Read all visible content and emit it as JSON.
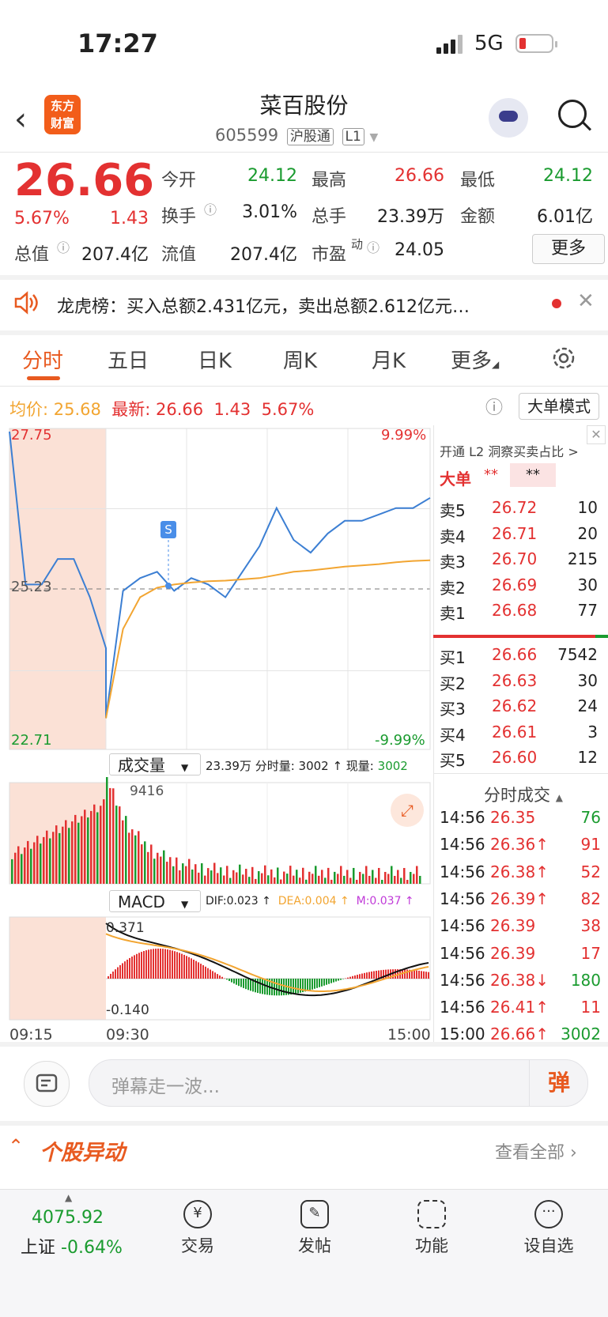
{
  "status_bar": {
    "time": "17:27",
    "network": "5G"
  },
  "header": {
    "title": "菜百股份",
    "code": "605599",
    "tag1": "沪股通",
    "tag2": "L1",
    "logo_line1": "东方",
    "logo_line2": "财富"
  },
  "quote": {
    "price": "26.66",
    "change_pct": "5.67%",
    "change": "1.43",
    "open_label": "今开",
    "open": "24.12",
    "high_label": "最高",
    "high": "26.66",
    "low_label": "最低",
    "low": "24.12",
    "turnover_label": "换手",
    "turnover": "3.01%",
    "volume_label": "总手",
    "volume": "23.39万",
    "amount_label": "金额",
    "amount": "6.01亿",
    "mktcap_label": "总值",
    "mktcap": "207.4亿",
    "float_label": "流值",
    "float": "207.4亿",
    "pe_label": "市盈",
    "pe_sup": "动",
    "pe": "24.05",
    "more_button": "更多"
  },
  "notice": {
    "text": "龙虎榜：买入总额2.431亿元，卖出总额2.612亿元…"
  },
  "tabs": [
    {
      "label": "分时"
    },
    {
      "label": "五日"
    },
    {
      "label": "日K"
    },
    {
      "label": "周K"
    },
    {
      "label": "月K"
    },
    {
      "label": "更多"
    }
  ],
  "avg_line": {
    "avg_label": "均价:",
    "avg": "25.68",
    "latest_label": "最新:",
    "latest": "26.66",
    "chg": "1.43",
    "pct": "5.67%"
  },
  "mode_button": "大单模式",
  "chart_labels": {
    "top_left": "27.75",
    "mid_left": "25.23",
    "bottom_left": "22.71",
    "top_right": "9.99%",
    "bottom_right": "-9.99%",
    "vol_selector": "成交量",
    "vol_info": "23.39万 分时量: 3002 ↑ 现量:",
    "vol_now": "3002",
    "vol_max": "9416",
    "macd_selector": "MACD",
    "dif": "DIF:0.023 ↑",
    "dea": "DEA:0.004 ↑",
    "m": "M:0.037 ↑",
    "macd_top": "0.371",
    "macd_bottom": "-0.140",
    "t_start": "09:15",
    "t_open": "09:30",
    "t_end": "15:00",
    "marker": "S"
  },
  "chart_data": {
    "type": "line",
    "ylim": [
      22.71,
      27.75
    ],
    "prev_close": 25.23,
    "x": [
      "09:15",
      "09:17",
      "09:19",
      "09:20",
      "09:22",
      "09:24",
      "09:25",
      "09:30",
      "09:35",
      "09:45",
      "09:55",
      "10:05",
      "10:20",
      "10:35",
      "10:50",
      "11:05",
      "11:15",
      "11:30",
      "13:15",
      "13:30",
      "13:45",
      "14:00",
      "14:15",
      "14:30",
      "14:45",
      "14:56",
      "15:00"
    ],
    "series": [
      {
        "values": [
          27.7,
          25.3,
          25.3,
          25.7,
          25.7,
          25.1,
          24.3,
          23.2,
          25.2,
          25.4,
          25.5,
          25.2,
          25.4,
          25.3,
          25.1,
          25.5,
          25.9,
          26.5,
          26.0,
          25.8,
          26.1,
          26.3,
          26.3,
          26.4,
          26.5,
          26.5,
          26.66
        ]
      },
      {
        "values": [
          null,
          null,
          null,
          null,
          null,
          null,
          null,
          23.2,
          24.6,
          25.1,
          25.25,
          25.3,
          25.33,
          25.35,
          25.36,
          25.38,
          25.4,
          25.45,
          25.5,
          25.52,
          25.55,
          25.58,
          25.6,
          25.62,
          25.65,
          25.67,
          25.68
        ]
      }
    ]
  },
  "order_book": {
    "header": "开通 L2 洞察买卖占比 >",
    "big_label": "大单",
    "big_val": "**",
    "big_val2": "**",
    "asks": [
      {
        "label": "卖5",
        "price": "26.72",
        "qty": "10"
      },
      {
        "label": "卖4",
        "price": "26.71",
        "qty": "20"
      },
      {
        "label": "卖3",
        "price": "26.70",
        "qty": "215"
      },
      {
        "label": "卖2",
        "price": "26.69",
        "qty": "30"
      },
      {
        "label": "卖1",
        "price": "26.68",
        "qty": "77"
      }
    ],
    "bids": [
      {
        "label": "买1",
        "price": "26.66",
        "qty": "7542"
      },
      {
        "label": "买2",
        "price": "26.63",
        "qty": "30"
      },
      {
        "label": "买3",
        "price": "26.62",
        "qty": "24"
      },
      {
        "label": "买4",
        "price": "26.61",
        "qty": "3"
      },
      {
        "label": "买5",
        "price": "26.60",
        "qty": "12"
      }
    ]
  },
  "trades": {
    "header": "分时成交",
    "rows": [
      {
        "time": "14:56",
        "price": "26.35",
        "qty": "76",
        "color": "green"
      },
      {
        "time": "14:56",
        "price": "26.36↑",
        "qty": "91",
        "color": "red"
      },
      {
        "time": "14:56",
        "price": "26.38↑",
        "qty": "52",
        "color": "red"
      },
      {
        "time": "14:56",
        "price": "26.39↑",
        "qty": "82",
        "color": "red"
      },
      {
        "time": "14:56",
        "price": "26.39",
        "qty": "38",
        "color": "red"
      },
      {
        "time": "14:56",
        "price": "26.39",
        "qty": "17",
        "color": "red"
      },
      {
        "time": "14:56",
        "price": "26.38↓",
        "qty": "180",
        "color": "green"
      },
      {
        "time": "14:56",
        "price": "26.41↑",
        "qty": "11",
        "color": "red"
      },
      {
        "time": "15:00",
        "price": "26.66↑",
        "qty": "3002",
        "color": "green"
      }
    ]
  },
  "comment": {
    "placeholder": "弹幕走一波...",
    "send": "弹"
  },
  "section": {
    "title": "个股异动",
    "link": "查看全部"
  },
  "bottom_nav": {
    "index_value": "4075.92",
    "index_name": "上证",
    "index_change": "-0.64%",
    "items": [
      {
        "label": "交易"
      },
      {
        "label": "发帖"
      },
      {
        "label": "功能"
      },
      {
        "label": "设自选"
      }
    ]
  }
}
